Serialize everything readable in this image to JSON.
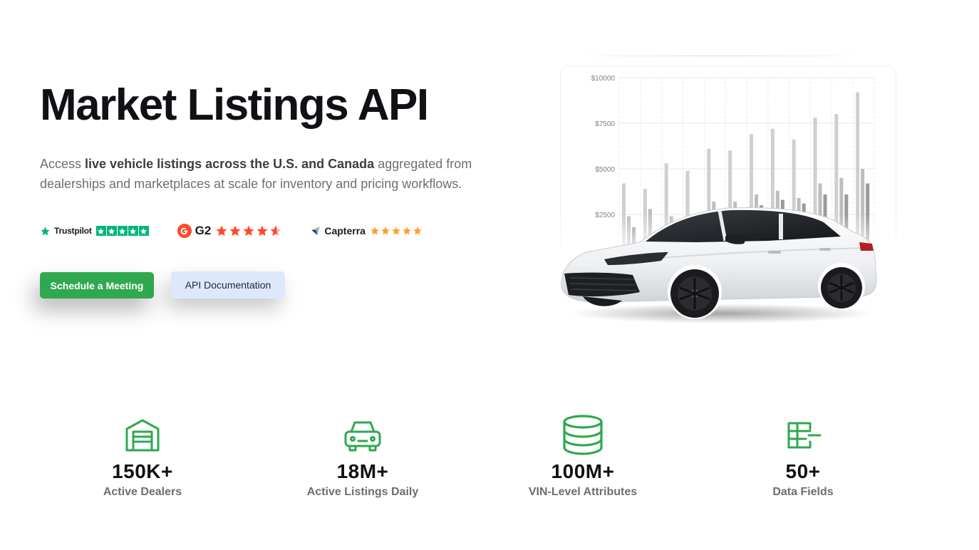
{
  "hero": {
    "title": "Market Listings API",
    "subtitle_part1": "Access ",
    "subtitle_bold": "live vehicle listings across the U.S. and Canada",
    "subtitle_part2": " aggregated from dealerships and marketplaces at scale for inventory and pricing workflows."
  },
  "ratings": {
    "trustpilot": {
      "brand": "Trustpilot",
      "stars": 5,
      "color": "#00b67a"
    },
    "g2": {
      "brand": "G2",
      "stars": 4.5,
      "color": "#ff492c"
    },
    "capterra": {
      "brand": "Capterra",
      "stars": 5,
      "color": "#ff9d28"
    }
  },
  "buttons": {
    "primary": "Schedule a Meeting",
    "secondary": "API Documentation"
  },
  "chart_data": {
    "type": "bar",
    "y_ticks": [
      "$10000",
      "$7500",
      "$5000",
      "$2500"
    ],
    "ylim": [
      0,
      10000
    ],
    "grid": true,
    "series": [
      {
        "values": [
          4200,
          3900,
          5300,
          4900,
          6100,
          6000,
          6900,
          7200,
          6600,
          7800,
          8000,
          9200
        ]
      },
      {
        "values": [
          2400,
          2800,
          2400,
          2400,
          3200,
          3200,
          3600,
          3800,
          3400,
          4200,
          4500,
          5000
        ]
      },
      {
        "values": [
          1800,
          1400,
          1800,
          1800,
          2600,
          2400,
          3000,
          3300,
          3100,
          3600,
          3600,
          4200
        ]
      }
    ]
  },
  "stats": [
    {
      "icon": "garage-icon",
      "value": "150K+",
      "label": "Active Dealers"
    },
    {
      "icon": "car-icon",
      "value": "18M+",
      "label": "Active Listings Daily"
    },
    {
      "icon": "database-icon",
      "value": "100M+",
      "label": "VIN-Level Attributes"
    },
    {
      "icon": "data-fields-icon",
      "value": "50+",
      "label": "Data Fields"
    }
  ],
  "colors": {
    "accent_green": "#2fa84f",
    "secondary_button_bg": "#dde9fb",
    "title": "#0f1115",
    "muted_text": "#6b6f75"
  }
}
